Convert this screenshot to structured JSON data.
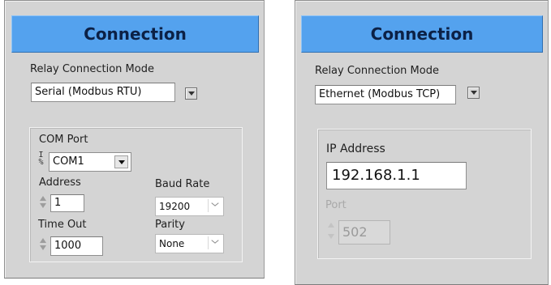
{
  "left_panel": {
    "title": "Connection",
    "relay_mode_label": "Relay Connection Mode",
    "relay_mode_value": "Serial (Modbus RTU)",
    "com_port_label": "COM Port",
    "com_port_value": "COM1",
    "address_label": "Address",
    "address_value": "1",
    "baud_rate_label": "Baud Rate",
    "baud_rate_value": "19200",
    "time_out_label": "Time Out",
    "time_out_value": "1000",
    "parity_label": "Parity",
    "parity_value": "None"
  },
  "right_panel": {
    "title": "Connection",
    "relay_mode_label": "Relay Connection Mode",
    "relay_mode_value": "Ethernet (Modbus TCP)",
    "ip_label": "IP Address",
    "ip_value": "192.168.1.1",
    "port_label": "Port",
    "port_value": "502"
  },
  "colors": {
    "title_bar": "#54a2ee",
    "panel_bg": "#d4d4d4",
    "title_text": "#0c2146"
  }
}
